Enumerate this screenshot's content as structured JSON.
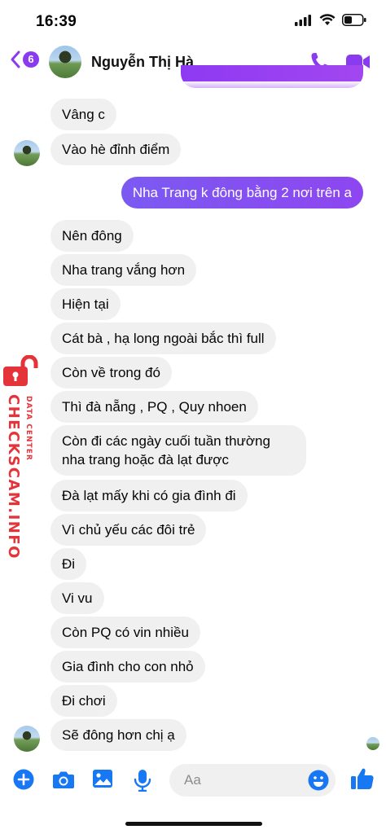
{
  "status_bar": {
    "time": "16:39"
  },
  "header": {
    "back_count": "6",
    "contact_name": "Nguyễn Thị Hà",
    "accent_color": "#8a3bf0"
  },
  "messages": [
    {
      "text": "Vâng c",
      "side": "received"
    },
    {
      "text": "Vào hè đỉnh điểm",
      "side": "received"
    },
    {
      "text": "Nha Trang k đông bằng 2 nơi trên a",
      "side": "sent"
    },
    {
      "text": "Nên đông",
      "side": "received"
    },
    {
      "text": "Nha trang vắng hơn",
      "side": "received"
    },
    {
      "text": "Hiện tại",
      "side": "received"
    },
    {
      "text": "Cát bà , hạ long ngoài bắc thì full",
      "side": "received"
    },
    {
      "text": "Còn về trong đó",
      "side": "received"
    },
    {
      "text": "Thì đà nẵng , PQ , Quy nhoen",
      "side": "received"
    },
    {
      "text": "Còn đi các ngày cuối tuần thường nha trang hoặc đà lạt được",
      "side": "received"
    },
    {
      "text": "Đà lạt mấy khi có gia đình đi",
      "side": "received"
    },
    {
      "text": "Vì chủ yếu các đôi trẻ",
      "side": "received"
    },
    {
      "text": "Đi",
      "side": "received"
    },
    {
      "text": "Vi vu",
      "side": "received"
    },
    {
      "text": "Còn PQ có vin nhiều",
      "side": "received"
    },
    {
      "text": "Gia đình cho con nhỏ",
      "side": "received"
    },
    {
      "text": "Đi chơi",
      "side": "received"
    },
    {
      "text": "Sẽ đông hơn chị ạ",
      "side": "received"
    }
  ],
  "watermark": {
    "main": "CHECKSCAM.INFO",
    "sub": "DATA CENTER",
    "color": "#e5333a"
  },
  "composer": {
    "placeholder": "Aa",
    "icons": [
      "plus-icon",
      "camera-icon",
      "image-icon",
      "microphone-icon",
      "emoji-icon",
      "thumbs-up-icon"
    ]
  }
}
